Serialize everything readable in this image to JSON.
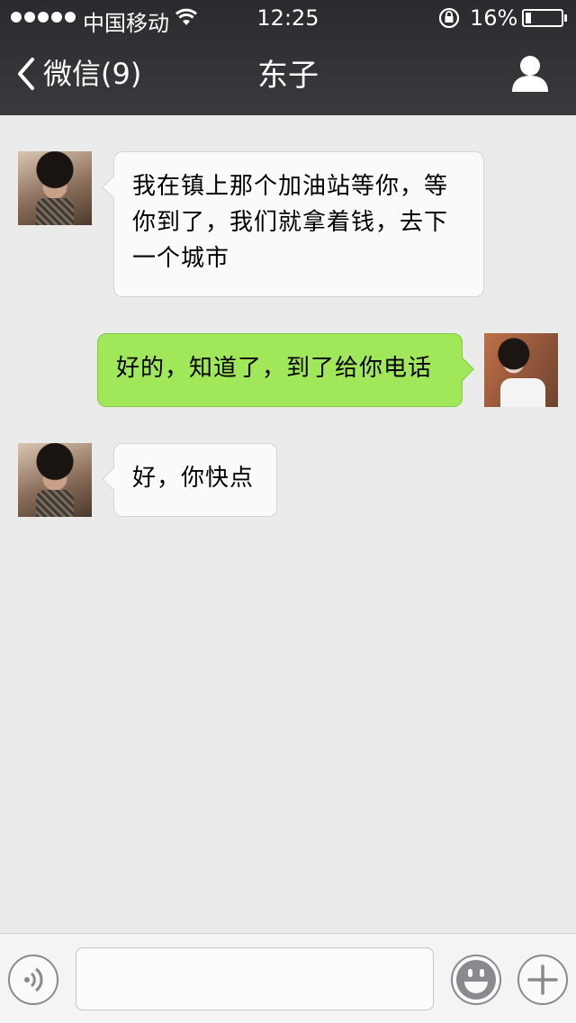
{
  "status_bar": {
    "carrier": "中国移动",
    "time": "12:25",
    "battery_percent": "16%",
    "battery_level": 0.16
  },
  "nav": {
    "back_label": "微信(9)",
    "title": "东子",
    "back_icon": "chevron-left-icon",
    "contact_icon": "person-icon"
  },
  "messages": [
    {
      "direction": "incoming",
      "sender": "东子",
      "text": "我在镇上那个加油站等你，等你到了，我们就拿着钱，去下一个城市"
    },
    {
      "direction": "outgoing",
      "text": "好的，知道了，到了给你电话"
    },
    {
      "direction": "incoming",
      "sender": "东子",
      "text": "好，你快点"
    }
  ],
  "input_bar": {
    "placeholder": "",
    "voice_icon": "voice-icon",
    "emoji_icon": "emoji-icon",
    "plus_icon": "plus-icon"
  },
  "colors": {
    "header_bg": "#2b2b2f",
    "chat_bg": "#ebebeb",
    "incoming_bubble": "#fafafa",
    "outgoing_bubble": "#a0e75a"
  }
}
